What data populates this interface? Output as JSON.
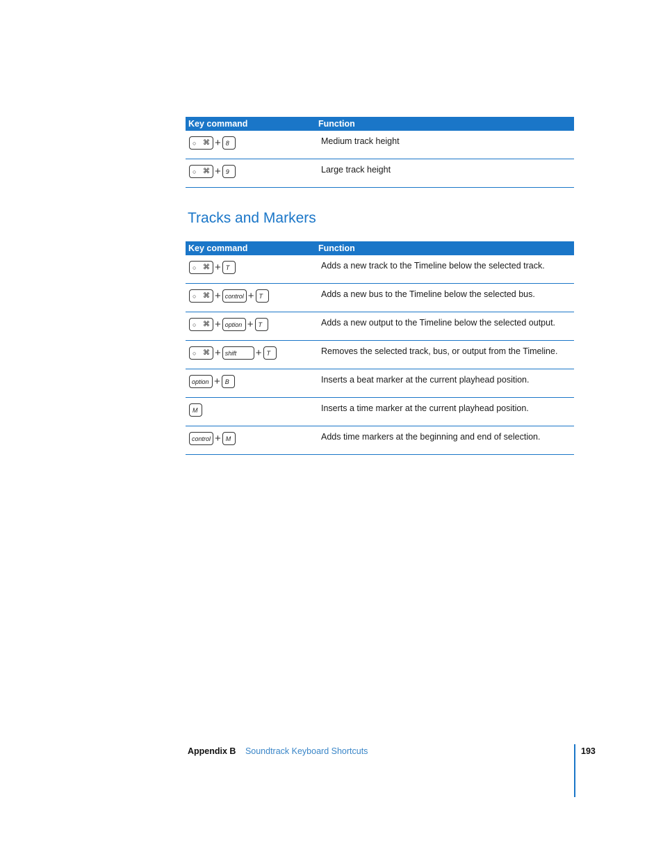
{
  "table1": {
    "headers": [
      "Key command",
      "Function"
    ],
    "rows": [
      {
        "keys": [
          {
            "type": "cmd",
            "label": "⌘"
          },
          {
            "type": "letter",
            "label": "8"
          }
        ],
        "function": "Medium track height"
      },
      {
        "keys": [
          {
            "type": "cmd",
            "label": "⌘"
          },
          {
            "type": "letter",
            "label": "9"
          }
        ],
        "function": "Large track height"
      }
    ]
  },
  "section": {
    "title": "Tracks and Markers"
  },
  "table2": {
    "headers": [
      "Key command",
      "Function"
    ],
    "rows": [
      {
        "keys": [
          {
            "type": "cmd",
            "label": "⌘"
          },
          {
            "type": "letter",
            "label": "T"
          }
        ],
        "function": "Adds a new track to the Timeline below the selected track."
      },
      {
        "keys": [
          {
            "type": "cmd",
            "label": "⌘"
          },
          {
            "type": "word",
            "label": "control"
          },
          {
            "type": "letter",
            "label": "T"
          }
        ],
        "function": "Adds a new bus to the Timeline below the selected bus."
      },
      {
        "keys": [
          {
            "type": "cmd",
            "label": "⌘"
          },
          {
            "type": "word",
            "label": "option"
          },
          {
            "type": "letter",
            "label": "T"
          }
        ],
        "function": "Adds a new output to the Timeline below the selected output."
      },
      {
        "keys": [
          {
            "type": "cmd",
            "label": "⌘"
          },
          {
            "type": "shift",
            "label": "shift"
          },
          {
            "type": "letter",
            "label": "T"
          }
        ],
        "function": "Removes the selected track, bus, or output from the Timeline."
      },
      {
        "keys": [
          {
            "type": "word",
            "label": "option"
          },
          {
            "type": "letter",
            "label": "B"
          }
        ],
        "function": "Inserts a beat marker at the current playhead position."
      },
      {
        "keys": [
          {
            "type": "letter",
            "label": "M"
          }
        ],
        "function": "Inserts a time marker at the current playhead position."
      },
      {
        "keys": [
          {
            "type": "word",
            "label": "control"
          },
          {
            "type": "letter",
            "label": "M"
          }
        ],
        "function": "Adds time markers at the beginning and end of selection."
      }
    ]
  },
  "footer": {
    "appendix": "Appendix B",
    "chapter": "Soundtrack Keyboard Shortcuts",
    "page_number": "193"
  },
  "icons": {
    "apple": "apple-icon",
    "command": "command-icon"
  },
  "colors": {
    "accent": "#1a76c8",
    "link": "#3a86c8"
  }
}
